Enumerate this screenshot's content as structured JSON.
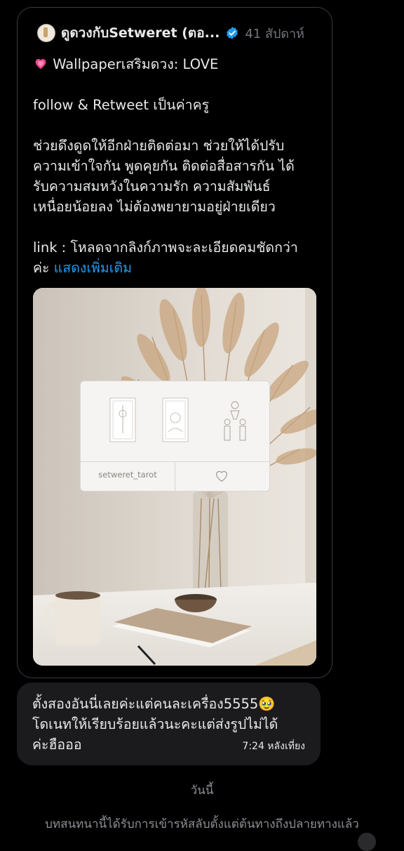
{
  "tweet": {
    "author_name": "ดูดวงกับSetweret (ตอ...",
    "time": "41 สัปดาห์",
    "title_line": "Wallpaperเสริมดวง: LOVE",
    "line_follow": "follow & Retweet เป็นค่าครู",
    "body_lines": [
      "ช่วยดึงดูดให้อีกฝ่ายติดต่อมา ช่วยให้ได้ปรับ",
      "ความเข้าใจกัน พูดคุยกัน ติดต่อสื่อสารกัน ได้",
      "รับความสมหวังในความรัก ความสัมพันธ์",
      "เหนื่อยน้อยลง ไม่ต้องพยายามอยู่ฝ่ายเดียว"
    ],
    "link_line": "link : โหลดจากลิงก์ภาพจะละเอียดคมชัดกว่า",
    "link_tail": "ค่ะ ",
    "show_more": "แสดงเพิ่มเติม",
    "media_card": {
      "username": "setweret_tarot",
      "like_icon": "heart-outline-icon"
    }
  },
  "message": {
    "line1": "ตั้งสองอันนี่เลยค่ะแต่คนละเครื่อง5555🥹",
    "line2": "โดเนทให้เรียบร้อยแล้วนะคะแต่ส่งรูปไม่ได้",
    "line3": "ค่ะฮือออ",
    "time": "7:24 หลังเที่ยง"
  },
  "day_separator": "วันนี้",
  "encryption_notice": "บทสนทนานี้ได้รับการเข้ารหัสลับตั้งแต่ต้นทางถึงปลายทางแล้ว",
  "colors": {
    "link_blue": "#1d9bf0",
    "bubble_bg": "#1b1b1d",
    "card_border": "#3a3b3d",
    "heart_pink": "#e8468a"
  }
}
